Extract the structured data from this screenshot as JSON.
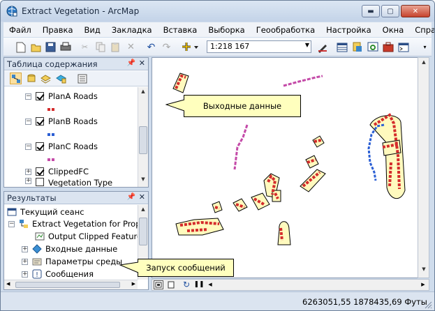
{
  "window": {
    "title": "Extract Vegetation - ArcMap"
  },
  "menu": [
    "Файл",
    "Правка",
    "Вид",
    "Закладка",
    "Вставка",
    "Выборка",
    "Геообработка",
    "Настройка",
    "Окна",
    "Справка"
  ],
  "toolbar": {
    "scale": "1:218 167"
  },
  "toc": {
    "title": "Таблица содержания",
    "layers": [
      {
        "name": "PlanA Roads",
        "checked": true,
        "color": "#d42b2b"
      },
      {
        "name": "PlanB Roads",
        "checked": true,
        "color": "#2b5fd4"
      },
      {
        "name": "PlanC Roads",
        "checked": true,
        "color": "#c44aa8"
      },
      {
        "name": "ClippedFC",
        "checked": true
      },
      {
        "name": "Vegetation Type",
        "checked": false
      }
    ]
  },
  "results": {
    "title": "Результаты",
    "items": [
      {
        "label": "Текущий сеанс"
      },
      {
        "label": "Extract Vegetation for Propo"
      },
      {
        "label": "Output Clipped Feature"
      },
      {
        "label": "Входные данные"
      },
      {
        "label": "Параметры среды"
      },
      {
        "label": "Сообщения"
      }
    ]
  },
  "callouts": {
    "output": "Выходные данные",
    "messages": "Запуск сообщений"
  },
  "status": {
    "coords": "6263051,55  1878435,69 Футы"
  },
  "colors": {
    "veg_fill": "#fffabe",
    "road_red": "#d42b2b",
    "road_blue": "#2b5fd4",
    "road_purple": "#c44aa8"
  }
}
